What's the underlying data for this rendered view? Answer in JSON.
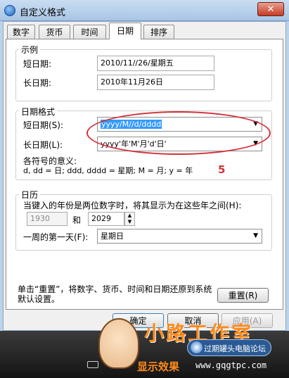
{
  "window": {
    "title": "自定义格式",
    "close": "✕"
  },
  "tabs": [
    "数字",
    "货币",
    "时间",
    "日期",
    "排序"
  ],
  "example": {
    "legend": "示例",
    "short_label": "短日期:",
    "short_value": "2010/11//26/星期五",
    "long_label": "长日期:",
    "long_value": "2010年11月26日"
  },
  "date_format": {
    "legend": "日期格式",
    "short_label": "短日期(S):",
    "short_value": "yyyy/M//d/dddd",
    "long_label": "长日期(L):",
    "long_value": "yyyy'年'M'月'd'日'",
    "symbols_title": "各符号的意义:",
    "symbols_text": "d, dd = 日;  ddd, dddd = 星期;  M = 月;  y = 年",
    "annotation": "5"
  },
  "calendar": {
    "legend": "日历",
    "two_digit_text": "当键入的年份是两位数字时，将其显示为在这些年之间(H):",
    "year_from": "1930",
    "and_label": "和",
    "year_to": "2029",
    "first_day_label": "一周的第一天(F):",
    "first_day_value": "星期日"
  },
  "reset_text": "单击“重置”，将数字、货币、时间和日期还原到系统默认设置。",
  "buttons": {
    "reset": "重置(R)",
    "ok": "确定",
    "cancel": "取消",
    "apply": "应用(A)"
  },
  "watermark": {
    "brand": "小路工作室",
    "forum": "过期罐头电脑论坛",
    "url": "www.gqgtpc.com",
    "bottom_text": "显示效果"
  },
  "colors": {
    "highlight": "#3399ff",
    "annotation_red": "#d2313a",
    "orange": "#ff8a1a"
  }
}
